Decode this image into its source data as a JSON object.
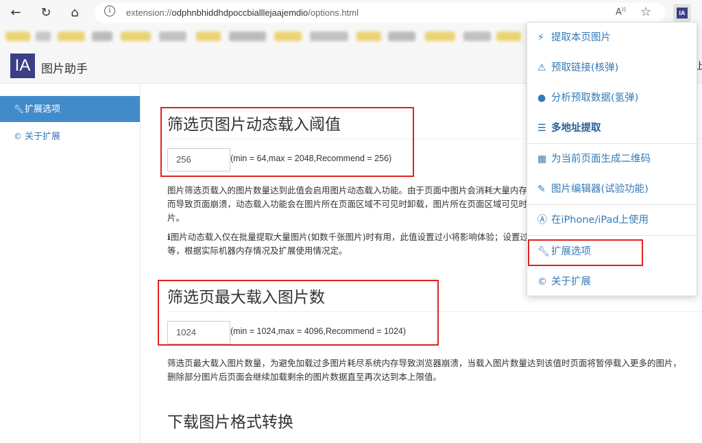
{
  "browser": {
    "url_prefix": "extension://",
    "url_host": "odphnbhiddhdpoccbialllejaajemdio",
    "url_path": "/options.html",
    "icons": {
      "back": "arrow-left-icon",
      "reload": "reload-icon",
      "home": "home-icon",
      "info": "info-icon",
      "read_aloud": "read-aloud-icon",
      "favorite": "star-icon",
      "extension": "extension-icon"
    },
    "extension_icon_text": "IA"
  },
  "header": {
    "logo_text": "IA",
    "brand": "图片助手",
    "right_fragment": "上"
  },
  "sidebar": {
    "items": [
      {
        "label": "扩展选项",
        "icon": "wrench-icon",
        "active": true
      },
      {
        "label": "关于扩展",
        "icon": "copyright-icon",
        "active": false
      }
    ]
  },
  "main": {
    "sections": [
      {
        "title": "筛选页图片动态载入阈值",
        "value": "256",
        "hint": "(min = 64,max = 2048,Recommend = 256)",
        "desc_lines": [
          "图片筛选页载入的图片数量达到此值会启用图片动态载入功能。由于页面中图片会消耗大量内存，在图片数量过多时可能会因内存不足",
          "而导致页面崩溃，动态载入功能会在图片所在页面区域不可见时卸载，图片所在页面区域可见时重新载入以减少内存消耗并保持流畅显示图",
          "片。"
        ],
        "note_lines": [
          "ℹ图片动态载入仅在批量提取大量图片(如数千张图片)时有用，此值设置过小将影响体验；设置过大则会增加内存消耗，推荐值为256或更高",
          "等，根据实际机器内存情况及扩展使用情况定。"
        ]
      },
      {
        "title": "筛选页最大载入图片数",
        "value": "1024",
        "hint": "(min = 1024,max = 4096,Recommend = 1024)",
        "desc_lines": [
          "筛选页最大载入图片数量，为避免加载过多图片耗尽系统内存导致浏览器崩溃，当载入图片数量达到该值时页面将暂停载入更多的图片，",
          "删除部分图片后页面会继续加载剩余的图片数据直至再次达到本上限值。"
        ]
      },
      {
        "title": "下载图片格式转换"
      }
    ]
  },
  "popup": {
    "items": [
      {
        "label": "提取本页图片",
        "icon": "lightning-icon"
      },
      {
        "label": "预取链接(核弹)",
        "icon": "warning-icon"
      },
      {
        "label": "分析预取数据(氢弹)",
        "icon": "bomb-icon"
      },
      {
        "label": "多地址提取",
        "icon": "list-icon"
      },
      {
        "label": "为当前页面生成二维码",
        "icon": "qrcode-icon"
      },
      {
        "label": "图片编辑器(试验功能)",
        "icon": "edit-icon"
      },
      {
        "label": "在iPhone/iPad上使用",
        "icon": "appstore-icon"
      },
      {
        "label": "扩展选项",
        "icon": "wrench-icon"
      },
      {
        "label": "关于扩展",
        "icon": "copyright-icon"
      }
    ]
  },
  "colors": {
    "accent": "#428bca",
    "link": "#337ab7",
    "brand": "#3b3f86",
    "highlight_box": "#e02020"
  }
}
